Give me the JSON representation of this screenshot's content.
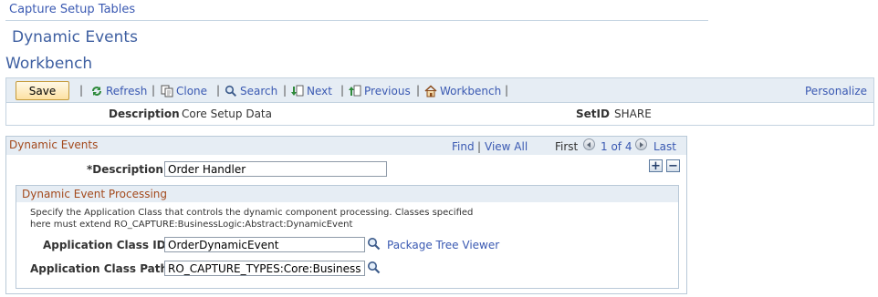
{
  "breadcrumb": "Capture Setup Tables",
  "page": {
    "title": "Dynamic Events",
    "subtitle": "Workbench"
  },
  "toolbar": {
    "save": "Save",
    "refresh": "Refresh",
    "clone": "Clone",
    "search": "Search",
    "next": "Next",
    "previous": "Previous",
    "workbench": "Workbench",
    "personalize": "Personalize",
    "separator": "|"
  },
  "info": {
    "description_label": "Description",
    "description_value": "Core Setup Data",
    "setid_label": "SetID",
    "setid_value": "SHARE"
  },
  "events": {
    "title": "Dynamic Events",
    "find": "Find",
    "view_all": "View All",
    "first": "First",
    "count": "1 of 4",
    "last": "Last",
    "separator": "|",
    "description_label": "*Description",
    "description_value": "Order Handler",
    "add": "+",
    "remove": "−"
  },
  "processing": {
    "title": "Dynamic Event Processing",
    "desc_line1": "Specify the Application Class that controls the dynamic component processing. Classes specified",
    "desc_line2": "here must extend RO_CAPTURE:BusinessLogic:Abstract:DynamicEvent",
    "class_id_label": "Application Class ID",
    "class_id_value": "OrderDynamicEvent",
    "package_tree_viewer": "Package Tree Viewer",
    "class_path_label": "Application Class Path",
    "class_path_value": "RO_CAPTURE_TYPES:Core:BusinessL"
  },
  "colors": {
    "link": "#3a59b2",
    "section_title": "#a3491c",
    "header_bg": "#e6edf4",
    "page_title": "#3e5fa1"
  }
}
